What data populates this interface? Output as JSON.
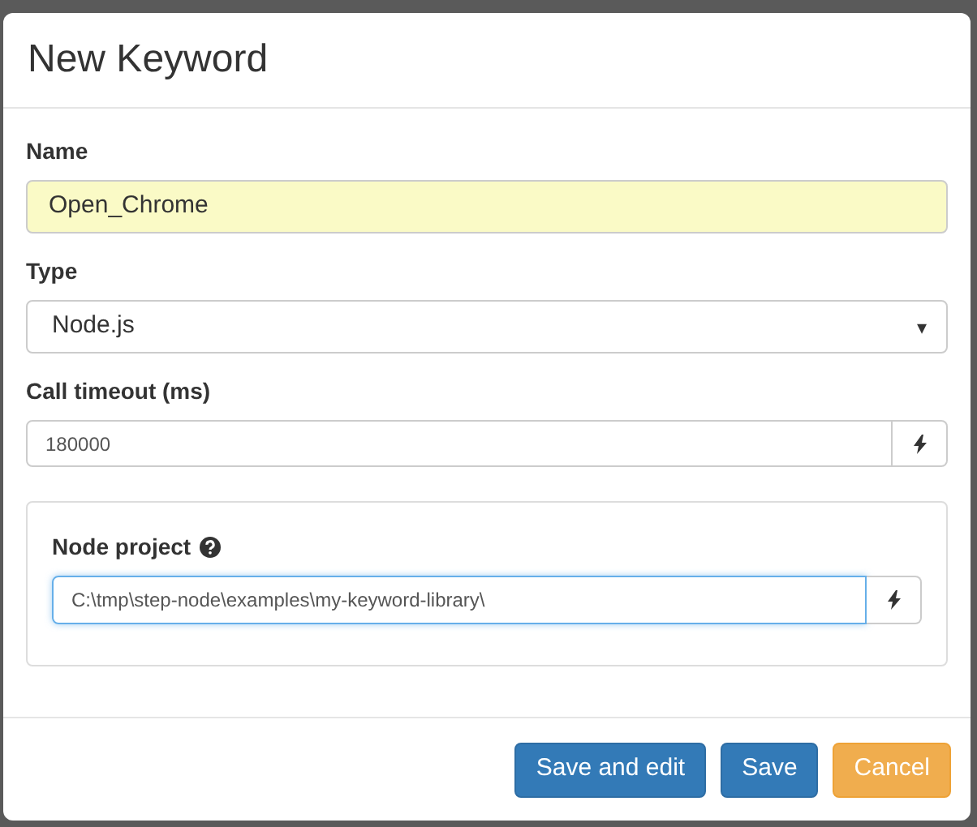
{
  "dialog": {
    "title": "New Keyword"
  },
  "fields": [
    {
      "kind": "text",
      "label": "Name",
      "value": "Open_Chrome",
      "highlighted": true
    },
    {
      "kind": "select",
      "label": "Type",
      "value": "Node.js",
      "caret": "▾"
    },
    {
      "kind": "addon",
      "label": "Call timeout (ms)",
      "value": "180000",
      "focused": false
    }
  ],
  "panel": {
    "label": "Node project",
    "value": "C:\\tmp\\step-node\\examples\\my-keyword-library\\",
    "focused": true
  },
  "buttons": [
    {
      "label": "Save and edit",
      "kind": "primary"
    },
    {
      "label": "Save",
      "kind": "primary"
    },
    {
      "label": "Cancel",
      "kind": "warning"
    }
  ]
}
